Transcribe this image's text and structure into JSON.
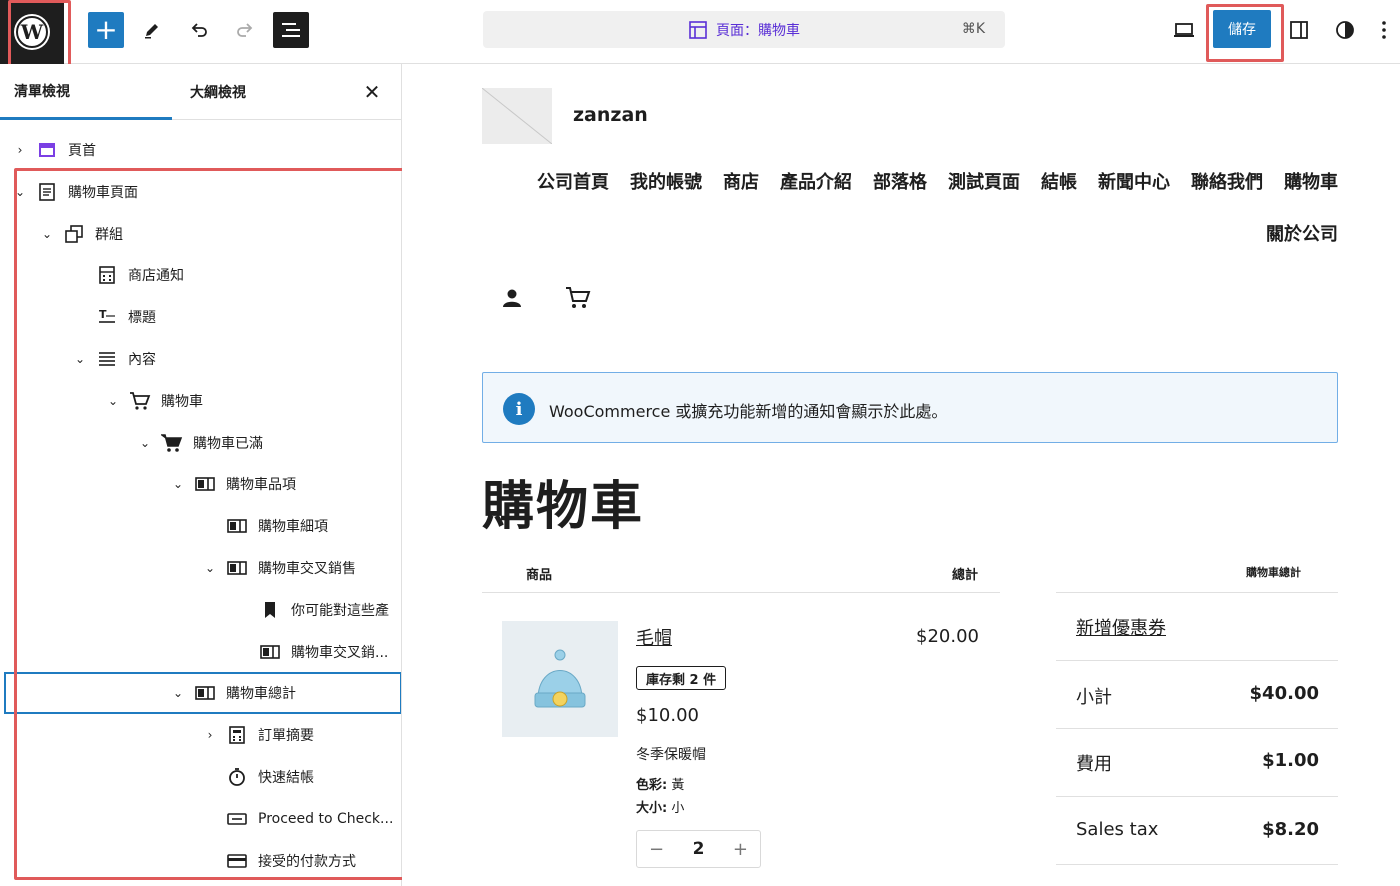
{
  "topbar": {
    "logo_letter": "W",
    "add_label": "+",
    "command_bar": {
      "label": "頁面：購物車",
      "shortcut": "⌘K"
    },
    "save_label": "儲存"
  },
  "sidebar": {
    "tabs": [
      "清單檢視",
      "大綱檢視"
    ],
    "close_label": "✕",
    "tree": [
      {
        "label": "頁首",
        "chevron": "›",
        "icon": "template-part-icon"
      },
      {
        "label": "購物車頁面",
        "chevron": "⌄",
        "icon": "page-icon"
      },
      {
        "label": "群組",
        "chevron": "⌄",
        "icon": "group-icon"
      },
      {
        "label": "商店通知",
        "chevron": "",
        "icon": "store-notice-icon"
      },
      {
        "label": "標題",
        "chevron": "",
        "icon": "title-icon"
      },
      {
        "label": "內容",
        "chevron": "⌄",
        "icon": "content-icon"
      },
      {
        "label": "購物車",
        "chevron": "⌄",
        "icon": "cart-outline-icon"
      },
      {
        "label": "購物車已滿",
        "chevron": "⌄",
        "icon": "cart-filled-icon"
      },
      {
        "label": "購物車品項",
        "chevron": "⌄",
        "icon": "column-block-icon"
      },
      {
        "label": "購物車細項",
        "chevron": "",
        "icon": "column-block-icon"
      },
      {
        "label": "購物車交叉銷售",
        "chevron": "⌄",
        "icon": "column-block-icon"
      },
      {
        "label": "你可能對這些產",
        "chevron": "",
        "icon": "bookmark-icon"
      },
      {
        "label": "購物車交叉銷...",
        "chevron": "",
        "icon": "column-block-icon"
      },
      {
        "label": "購物車總計",
        "chevron": "⌄",
        "icon": "column-block-icon"
      },
      {
        "label": "訂單摘要",
        "chevron": "›",
        "icon": "calculator-icon"
      },
      {
        "label": "快速結帳",
        "chevron": "",
        "icon": "stopwatch-icon"
      },
      {
        "label": "Proceed to Check...",
        "chevron": "",
        "icon": "button-icon"
      },
      {
        "label": "接受的付款方式",
        "chevron": "",
        "icon": "card-icon"
      }
    ]
  },
  "canvas": {
    "site_name": "zanzan",
    "nav": [
      "公司首頁",
      "我的帳號",
      "商店",
      "產品介紹",
      "部落格",
      "測試頁面",
      "結帳",
      "新聞中心",
      "聯絡我們",
      "購物車",
      "關於公司"
    ],
    "notice_text": "WooCommerce 或擴充功能新增的通知會顯示於此處。",
    "notice_icon": "i",
    "title": "購物車",
    "table_headers": {
      "product": "商品",
      "total": "總計",
      "cart_totals": "購物車總計"
    },
    "item": {
      "name": "毛帽",
      "line_total": "$20.00",
      "stock_badge": "庫存剩 2 件",
      "unit_price": "$10.00",
      "description": "冬季保暖帽",
      "meta": [
        {
          "key": "色彩:",
          "value": "黃"
        },
        {
          "key": "大小:",
          "value": "小"
        }
      ],
      "quantity": "2",
      "minus": "−",
      "plus": "+"
    },
    "totals": {
      "coupon": "新增優惠券",
      "rows": [
        {
          "label": "小計",
          "value": "$40.00"
        },
        {
          "label": "費用",
          "value": "$1.00"
        },
        {
          "label": "Sales tax",
          "value": "$8.20"
        }
      ]
    }
  }
}
